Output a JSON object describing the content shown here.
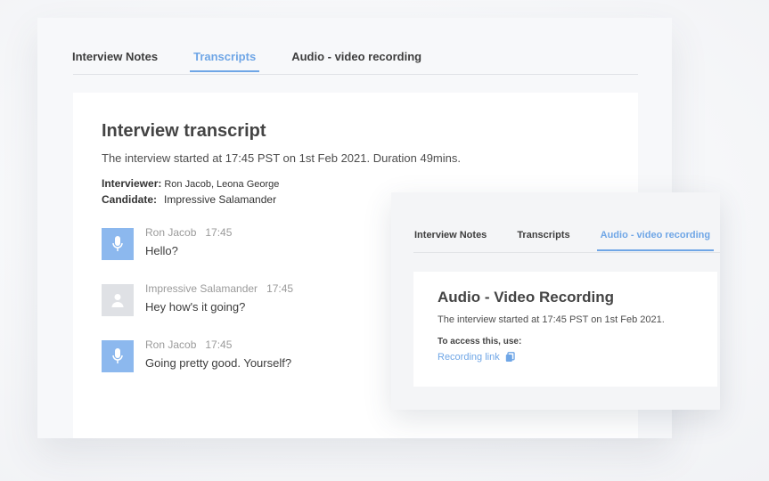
{
  "colors": {
    "accent": "#6fa6e6",
    "avatar_interviewer": "#8cb8ee",
    "avatar_candidate": "#dfe1e5"
  },
  "tabs": [
    {
      "label": "Interview Notes",
      "active": false
    },
    {
      "label": "Transcripts",
      "active": true
    },
    {
      "label": "Audio - video recording",
      "active": false
    }
  ],
  "transcript": {
    "title": "Interview transcript",
    "started": "The interview started at 17:45 PST on 1st Feb 2021. Duration 49mins.",
    "interviewer_label": "Interviewer:",
    "interviewer_value": "Ron Jacob, Leona George",
    "candidate_label": "Candidate:",
    "candidate_value": "Impressive Salamander",
    "messages": [
      {
        "speaker": "Ron Jacob",
        "time": "17:45",
        "text": "Hello?",
        "avatar": "microphone-icon"
      },
      {
        "speaker": "Impressive Salamander",
        "time": "17:45",
        "text": "Hey how's it going?",
        "avatar": "user-icon"
      },
      {
        "speaker": "Ron Jacob",
        "time": "17:45",
        "text": "Going pretty good. Yourself?",
        "avatar": "microphone-icon"
      }
    ]
  },
  "overlay": {
    "tabs": [
      {
        "label": "Interview Notes",
        "active": false
      },
      {
        "label": "Transcripts",
        "active": false
      },
      {
        "label": "Audio - video recording",
        "active": true
      }
    ],
    "title": "Audio - Video Recording",
    "started": "The interview started at 17:45 PST on 1st Feb 2021.",
    "access_label": "To access this, use:",
    "link_label": "Recording link",
    "link_icon": "copy-icon"
  }
}
